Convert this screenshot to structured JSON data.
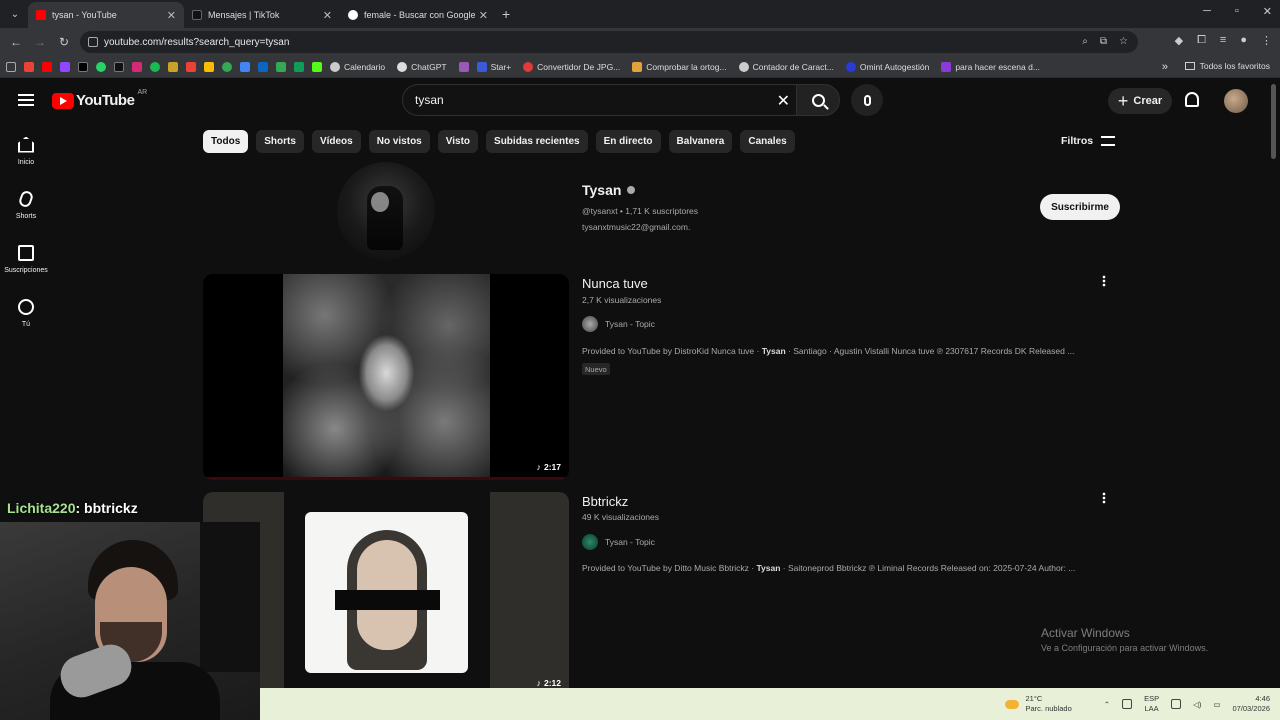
{
  "browser": {
    "tabs": [
      {
        "title": "tysan - YouTube",
        "color": "#ff0000"
      },
      {
        "title": "Mensajes | TikTok",
        "color": "#111111"
      },
      {
        "title": "female - Buscar con Google",
        "color": "#4285f4"
      }
    ],
    "url": "youtube.com/results?search_query=tysan",
    "bookmarks": [
      {
        "label": "Calendario",
        "color": "#cccccc"
      },
      {
        "label": "ChatGPT",
        "color": "#dddddd"
      },
      {
        "label": "Star+",
        "color": "#3a5bd9"
      },
      {
        "label": "Convertidor De JPG...",
        "color": "#e03a3a"
      },
      {
        "label": "Comprobar la ortog...",
        "color": "#e0a23a"
      },
      {
        "label": "Contador de Caract...",
        "color": "#cccccc"
      },
      {
        "label": "Omint Autogestión",
        "color": "#2a3ad9"
      },
      {
        "label": "para hacer escena d...",
        "color": "#8a3ad9"
      }
    ],
    "all_bookmarks": "Todos los favoritos"
  },
  "youtube": {
    "logo": "YouTube",
    "region": "AR",
    "search_query": "tysan",
    "create_label": "Crear",
    "sidebar": [
      {
        "label": "Inicio",
        "icon": "home-icon"
      },
      {
        "label": "Shorts",
        "icon": "shorts-icon"
      },
      {
        "label": "Suscripciones",
        "icon": "subscriptions-icon"
      },
      {
        "label": "Tú",
        "icon": "you-icon"
      }
    ],
    "chips": [
      "Todos",
      "Shorts",
      "Vídeos",
      "No vistos",
      "Visto",
      "Subidas recientes",
      "En directo",
      "Balvanera",
      "Canales"
    ],
    "filters_label": "Filtros",
    "channel": {
      "name": "Tysan",
      "meta": "@tysanxt • 1,71 K suscriptores",
      "desc": "tysanxtmusic22@gmail.com.",
      "subscribe": "Suscribirme"
    },
    "videos": [
      {
        "title": "Nunca tuve",
        "views": "2,7 K visualizaciones",
        "channel": "Tysan - Topic",
        "desc_pre": "Provided to YouTube by DistroKid Nunca tuve · ",
        "desc_bold": "Tysan",
        "desc_post": " · Santiago · Agustin Vistalli Nunca tuve ℗ 2307617 Records DK Released ...",
        "badge": "Nuevo",
        "duration": "2:17"
      },
      {
        "title": "Bbtrickz",
        "views": "49 K visualizaciones",
        "channel": "Tysan - Topic",
        "desc_pre": "Provided to YouTube by Ditto Music Bbtrickz · ",
        "desc_bold": "Tysan",
        "desc_post": " · Saitoneprod Bbtrickz ℗ Liminal Records Released on: 2025-07-24 Author: ...",
        "duration": "2:12"
      }
    ]
  },
  "watermark": {
    "line1": "Activar Windows",
    "line2": "Ve a Configuración para activar Windows."
  },
  "overlay": {
    "user": "Lichita220",
    "message": ": bbtrickz"
  },
  "taskbar": {
    "temp": "21°C",
    "weather": "Parc. nublado",
    "lang1": "ESP",
    "lang2": "LAA",
    "time": "4:46",
    "date": "07/03/2026"
  }
}
